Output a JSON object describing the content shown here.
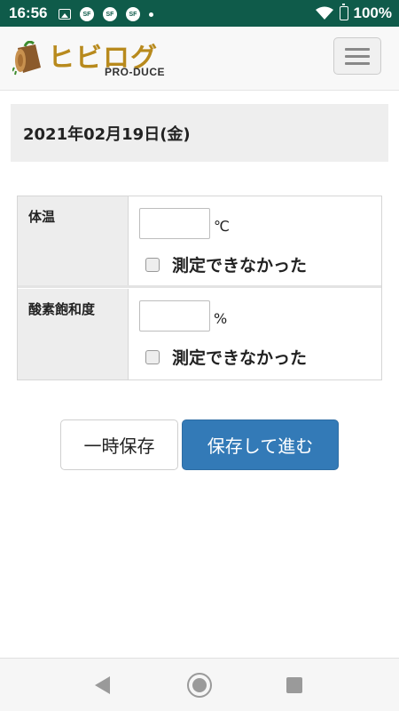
{
  "status_bar": {
    "time": "16:56",
    "icons": [
      "image-notification-icon",
      "sf-notification-icon",
      "sf-notification-icon",
      "sf-notification-icon",
      "more-dot-icon"
    ],
    "battery": "100%"
  },
  "header": {
    "brand": "ヒビログ",
    "brand_sub": "PRO-DUCE",
    "menu_icon": "hamburger-menu-icon"
  },
  "date": {
    "text": "2021年02月19日(金)"
  },
  "form": {
    "rows": [
      {
        "label": "体温",
        "value": "",
        "unit": "℃",
        "checkbox_label": "測定できなかった",
        "checked": false
      },
      {
        "label": "酸素飽和度",
        "value": "",
        "unit": "%",
        "checkbox_label": "測定できなかった",
        "checked": false
      }
    ]
  },
  "buttons": {
    "temp_save": "一時保存",
    "save_next": "保存して進む"
  },
  "colors": {
    "status_bar": "#0f5b4a",
    "primary_button": "#337ab7",
    "brand": "#b88a1d"
  }
}
